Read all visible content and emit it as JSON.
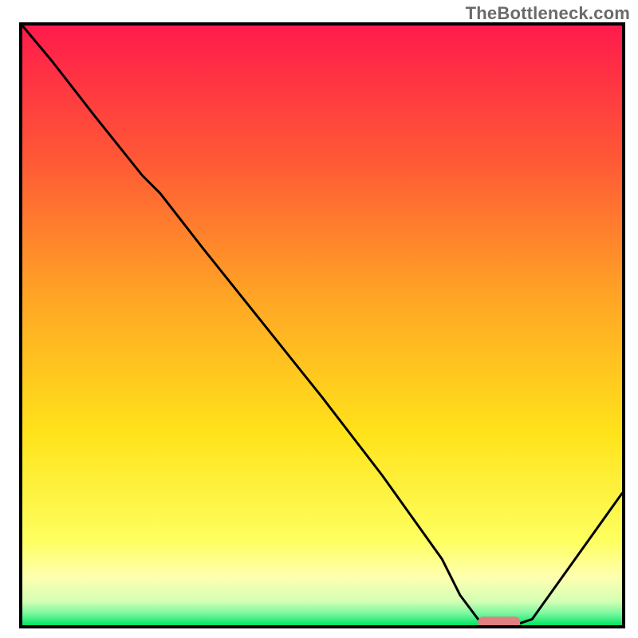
{
  "watermark": "TheBottleneck.com",
  "chart_data": {
    "type": "line",
    "title": "",
    "xlabel": "",
    "ylabel": "",
    "xlim": [
      0,
      100
    ],
    "ylim": [
      0,
      100
    ],
    "grid": false,
    "gradient": {
      "top_color": "#ff1b4c",
      "mid_upper_color": "#ff8a2a",
      "mid_color": "#ffe31a",
      "lower_band_color": "#feffb0",
      "bottom_color": "#00e560"
    },
    "x": [
      0,
      5,
      12,
      20,
      23,
      30,
      40,
      50,
      60,
      70,
      73,
      76,
      80,
      82,
      85,
      90,
      95,
      100
    ],
    "values": [
      100,
      94,
      85,
      75,
      72,
      63,
      50.5,
      38,
      25,
      11,
      5,
      1,
      0,
      0,
      1,
      8,
      15,
      22
    ],
    "marker": {
      "shape": "rounded-rect",
      "color": "#e08080",
      "x_start": 76,
      "x_end": 83,
      "y": 0.5
    }
  }
}
